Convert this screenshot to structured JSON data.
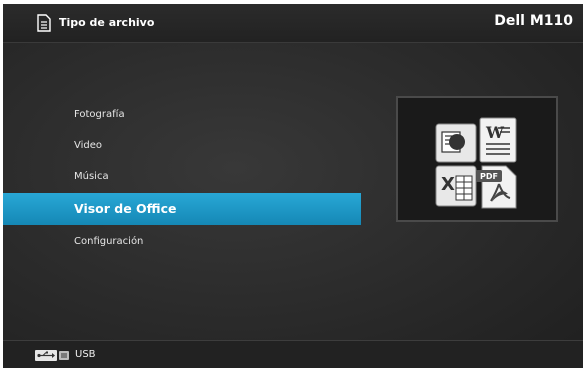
{
  "header": {
    "title": "Tipo de archivo",
    "model": "Dell M110",
    "icon": "document-icon"
  },
  "menu": {
    "items": [
      {
        "label": "Fotografía",
        "selected": false
      },
      {
        "label": "Video",
        "selected": false
      },
      {
        "label": "Música",
        "selected": false
      },
      {
        "label": "Visor de Office",
        "selected": true
      },
      {
        "label": "Configuración",
        "selected": false
      }
    ],
    "accent_color": "#1b97c8"
  },
  "preview": {
    "icon": "office-documents-icon"
  },
  "footer": {
    "source_label": "USB",
    "icon": "usb-icon"
  }
}
